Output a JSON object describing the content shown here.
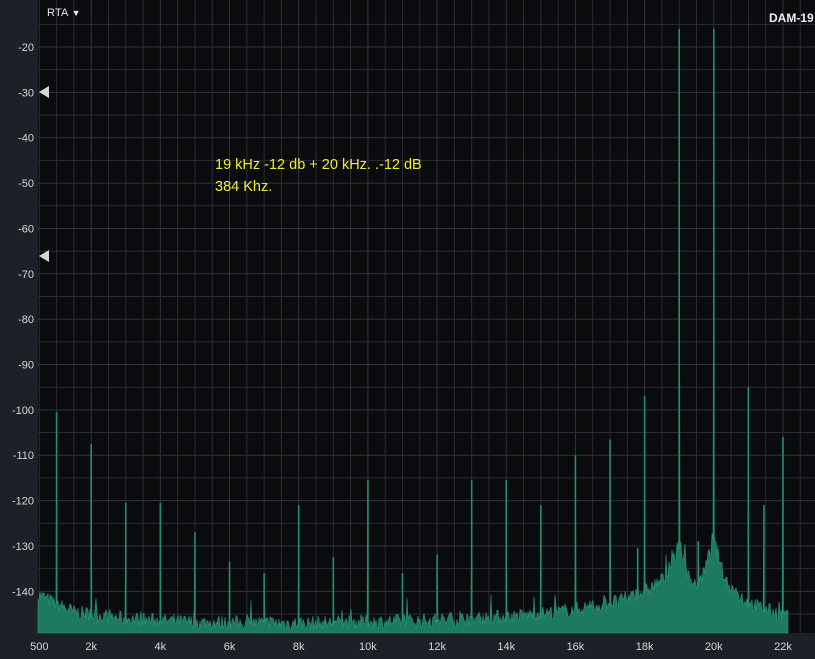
{
  "toolbar": {
    "mode_label": "RTA",
    "mode_caret": "▼",
    "device_label": "DAM-19"
  },
  "annotation": {
    "line1": "19 kHz -12 db + 20 kHz. .-12 dB",
    "line2": "384 Khz."
  },
  "colors": {
    "background": "#1c2027",
    "plot_bg": "#0a0b0d",
    "grid": "#2a2d33",
    "trace": "#1d7a5f",
    "annotation": "#f2ee2e"
  },
  "chart_data": {
    "type": "line",
    "x_unit": "Hz",
    "xlim": [
      0,
      22400
    ],
    "ylim": [
      -150,
      -14
    ],
    "grid": true,
    "y_ticks": [
      -20,
      -30,
      -40,
      -50,
      -60,
      -70,
      -80,
      -90,
      -100,
      -110,
      -120,
      -130,
      -140
    ],
    "y_tick_labels": [
      "-20",
      "-30",
      "-40",
      "-50",
      "-60",
      "-70",
      "-80",
      "-90",
      "-100",
      "-110",
      "-120",
      "-130",
      "-140"
    ],
    "x_ticks": [
      500,
      2000,
      4000,
      6000,
      8000,
      10000,
      12000,
      14000,
      16000,
      18000,
      20000,
      22000
    ],
    "x_tick_labels": [
      "500",
      "2k",
      "4k",
      "6k",
      "8k",
      "10k",
      "12k",
      "14k",
      "16k",
      "18k",
      "20k",
      "22k"
    ],
    "handles_db": [
      -30,
      -66
    ],
    "noise_floor": [
      [
        0,
        -137
      ],
      [
        300,
        -140
      ],
      [
        800,
        -142
      ],
      [
        1500,
        -144.5
      ],
      [
        3000,
        -146
      ],
      [
        5000,
        -146.8
      ],
      [
        8000,
        -147
      ],
      [
        11000,
        -146.6
      ],
      [
        13000,
        -146
      ],
      [
        14500,
        -145.3
      ],
      [
        15500,
        -144.5
      ],
      [
        16500,
        -143.3
      ],
      [
        17300,
        -142
      ],
      [
        18000,
        -140
      ],
      [
        18600,
        -137
      ],
      [
        18900,
        -132
      ],
      [
        19000,
        -129
      ],
      [
        19100,
        -132
      ],
      [
        19300,
        -137.5
      ],
      [
        19500,
        -138.5
      ],
      [
        19700,
        -136
      ],
      [
        19900,
        -131
      ],
      [
        20000,
        -128.5
      ],
      [
        20100,
        -131
      ],
      [
        20300,
        -137
      ],
      [
        20600,
        -140
      ],
      [
        21000,
        -142.5
      ],
      [
        21500,
        -144
      ],
      [
        22000,
        -145
      ],
      [
        22150,
        -145.2
      ]
    ],
    "peaks": [
      {
        "f": 1000,
        "db": -100.5
      },
      {
        "f": 2000,
        "db": -107.5
      },
      {
        "f": 3000,
        "db": -120.5
      },
      {
        "f": 4000,
        "db": -120.5
      },
      {
        "f": 5000,
        "db": -127.0
      },
      {
        "f": 6000,
        "db": -133.5
      },
      {
        "f": 7000,
        "db": -136.0
      },
      {
        "f": 8000,
        "db": -121.0
      },
      {
        "f": 9000,
        "db": -132.5
      },
      {
        "f": 10000,
        "db": -115.5
      },
      {
        "f": 11000,
        "db": -136.0
      },
      {
        "f": 12000,
        "db": -132.0
      },
      {
        "f": 13000,
        "db": -115.5
      },
      {
        "f": 14000,
        "db": -115.5
      },
      {
        "f": 15000,
        "db": -121.0
      },
      {
        "f": 16000,
        "db": -110.0
      },
      {
        "f": 17000,
        "db": -106.5
      },
      {
        "f": 17800,
        "db": -130.5
      },
      {
        "f": 18000,
        "db": -97.0
      },
      {
        "f": 19000,
        "db": -16.0
      },
      {
        "f": 19550,
        "db": -129.0
      },
      {
        "f": 20000,
        "db": -16.0
      },
      {
        "f": 21000,
        "db": -95.0
      },
      {
        "f": 21450,
        "db": -121.0
      },
      {
        "f": 22000,
        "db": -106.0
      }
    ]
  }
}
